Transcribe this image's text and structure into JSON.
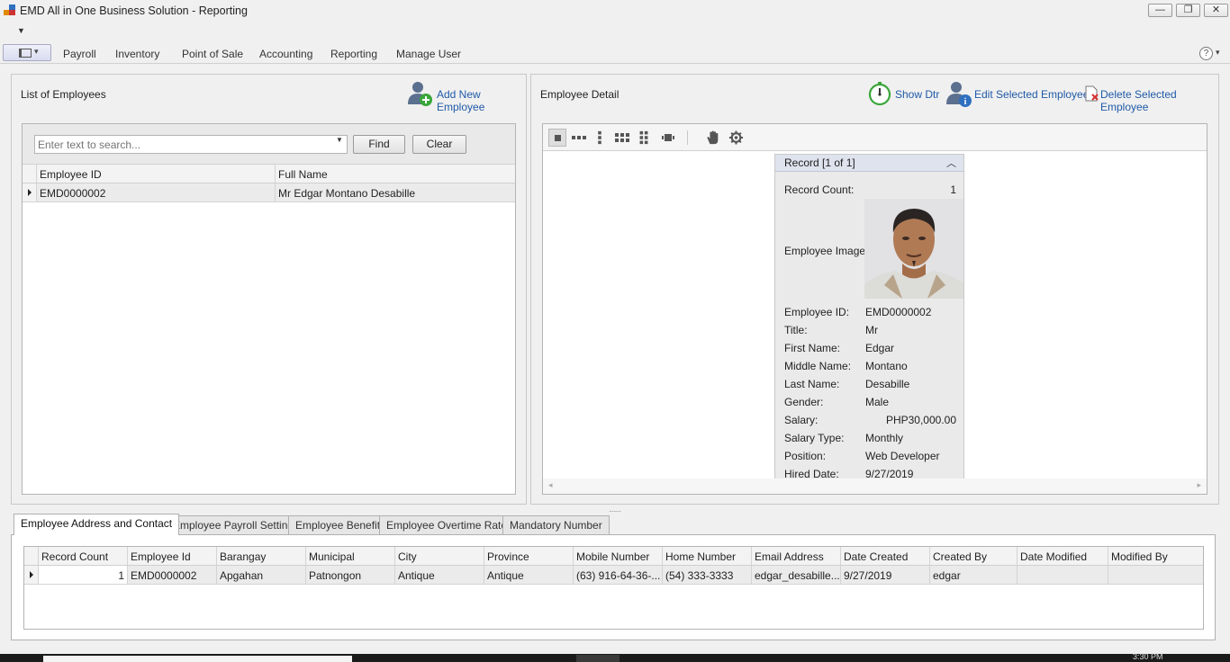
{
  "window": {
    "title": "EMD All in One Business Solution - Reporting",
    "minimize": "—",
    "restore": "❐",
    "close": "✕",
    "qat_glyph": "▼"
  },
  "menu": {
    "app_button_chevron": "▾",
    "items": [
      "Payroll",
      "Inventory",
      "Point of Sale",
      "Accounting",
      "Reporting",
      "Manage User"
    ],
    "help_glyph": "?",
    "help_chevron": "▾"
  },
  "employees_panel": {
    "title": "List of Employees",
    "add_new_label": "Add New Employee",
    "search": {
      "placeholder": "Enter text to search...",
      "dropdown_glyph": "▼",
      "find_label": "Find",
      "clear_label": "Clear"
    },
    "columns": [
      "Employee ID",
      "Full Name"
    ],
    "rows": [
      [
        "EMD0000002",
        "Mr Edgar Montano Desabille"
      ]
    ]
  },
  "detail_panel": {
    "title": "Employee Detail",
    "show_dtr_label": "Show Dtr",
    "edit_label": "Edit Selected Employee",
    "delete_label": "Delete Selected Employee",
    "record_header": "Record [1 of 1]",
    "collapse_glyph": "︿",
    "record_count_label": "Record Count:",
    "record_count_value": "1",
    "image_label": "Employee Image:",
    "fields": [
      {
        "label": "Employee ID:",
        "value": "EMD0000002"
      },
      {
        "label": "Title:",
        "value": "Mr"
      },
      {
        "label": "First Name:",
        "value": "Edgar"
      },
      {
        "label": "Middle Name:",
        "value": "Montano"
      },
      {
        "label": "Last Name:",
        "value": "Desabille"
      },
      {
        "label": "Gender:",
        "value": "Male"
      },
      {
        "label": "Salary:",
        "value": "PHP30,000.00"
      },
      {
        "label": "Salary Type:",
        "value": "Monthly"
      },
      {
        "label": "Position:",
        "value": "Web Developer"
      },
      {
        "label": "Hired Date:",
        "value": "9/27/2019"
      }
    ],
    "scroll_left": "◂",
    "scroll_right": "▸"
  },
  "splitter_glyph": "········",
  "tabs": [
    {
      "label": "Employee Address and Contact",
      "active": true
    },
    {
      "label": "Employee Payroll Setting",
      "active": false
    },
    {
      "label": "Employee Benefit",
      "active": false
    },
    {
      "label": "Employee Overtime Rate",
      "active": false
    },
    {
      "label": "Mandatory Number",
      "active": false
    }
  ],
  "address_grid": {
    "columns": [
      "Record Count",
      "Employee Id",
      "Barangay",
      "Municipal",
      "City",
      "Province",
      "Mobile Number",
      "Home Number",
      "Email Address",
      "Date Created",
      "Created By",
      "Date Modified",
      "Modified By"
    ],
    "rows": [
      [
        "1",
        "EMD0000002",
        "Apgahan",
        "Patnongon",
        "Antique",
        "Antique",
        "(63) 916-64-36-...",
        "(54) 333-3333",
        "edgar_desabille...",
        "9/27/2019",
        "edgar",
        "",
        ""
      ]
    ]
  },
  "taskbar": {
    "clock": "3:30 PM"
  },
  "colors": {
    "link": "#1f5aa8",
    "add_icon_green": "#3aa63a",
    "delete_red": "#d63030",
    "person_icon": "#5b6f8f"
  }
}
